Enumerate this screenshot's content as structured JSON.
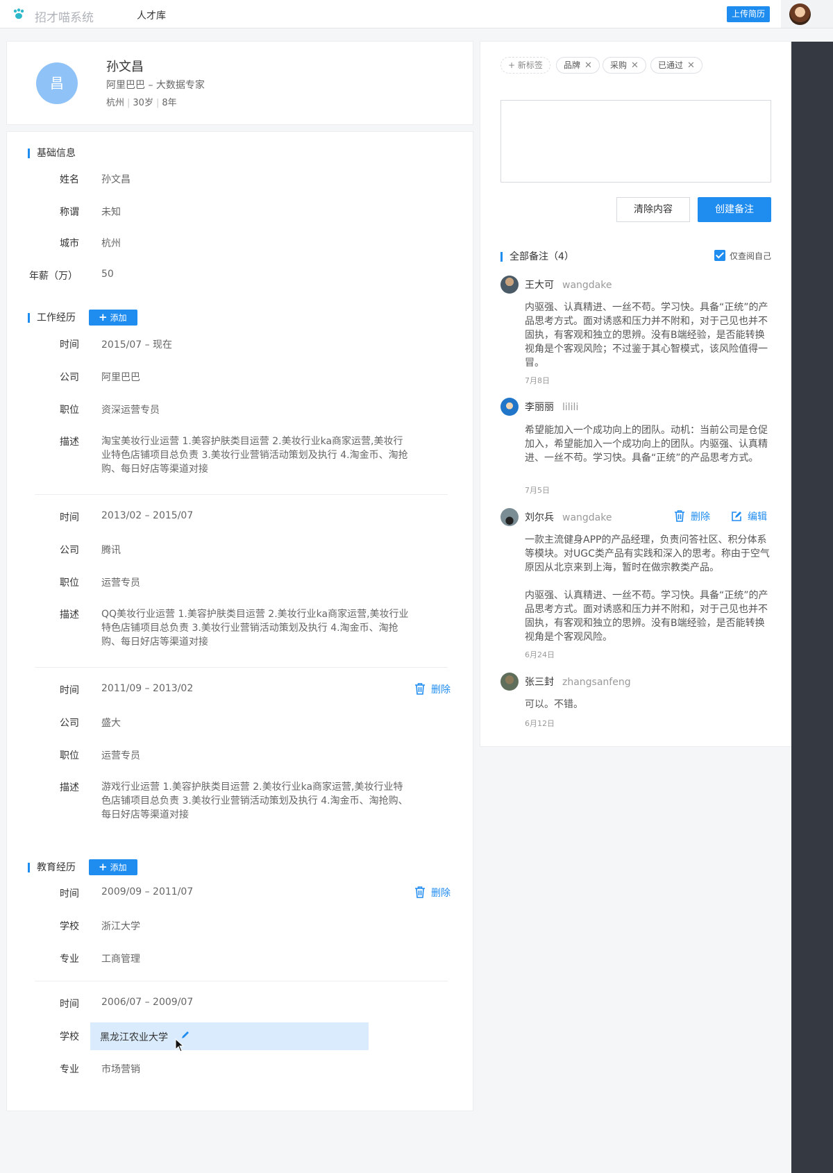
{
  "topbar": {
    "brand": "招才喵系统",
    "nav": "人才库",
    "upload": "上传简历"
  },
  "profile": {
    "avatar_char": "昌",
    "name": "孙文昌",
    "title": "阿里巴巴 – 大数据专家",
    "city": "杭州",
    "age": "30岁",
    "years": "8年"
  },
  "basic": {
    "title": "基础信息",
    "rows": [
      {
        "label": "姓名",
        "value": "孙文昌"
      },
      {
        "label": "称谓",
        "value": "未知"
      },
      {
        "label": "城市",
        "value": "杭州"
      },
      {
        "label": "年薪（万）",
        "value": "50"
      }
    ]
  },
  "work": {
    "title": "工作经历",
    "add": "添加",
    "labels": {
      "time": "时间",
      "company": "公司",
      "position": "职位",
      "desc": "描述"
    },
    "delete": "删除",
    "items": [
      {
        "time": "2015/07 – 现在",
        "company": "阿里巴巴",
        "position": "资深运营专员",
        "desc": "淘宝美妆行业运营 1.美容护肤类目运营 2.美妆行业ka商家运营,美妆行业特色店铺项目总负责 3.美妆行业营销活动策划及执行 4.淘金币、淘抢购、每日好店等渠道对接"
      },
      {
        "time": "2013/02 – 2015/07",
        "company": "腾讯",
        "position": "运营专员",
        "desc": "QQ美妆行业运营 1.美容护肤类目运营 2.美妆行业ka商家运营,美妆行业特色店铺项目总负责 3.美妆行业营销活动策划及执行 4.淘金币、淘抢购、每日好店等渠道对接"
      },
      {
        "time": "2011/09 – 2013/02",
        "company": "盛大",
        "position": "运营专员",
        "desc": "游戏行业运营 1.美容护肤类目运营 2.美妆行业ka商家运营,美妆行业特色店铺项目总负责 3.美妆行业营销活动策划及执行 4.淘金币、淘抢购、每日好店等渠道对接"
      }
    ]
  },
  "edu": {
    "title": "教育经历",
    "add": "添加",
    "labels": {
      "time": "时间",
      "school": "学校",
      "major": "专业"
    },
    "delete": "删除",
    "items": [
      {
        "time": "2009/09 – 2011/07",
        "school": "浙江大学",
        "major": "工商管理"
      },
      {
        "time": "2006/07 – 2009/07",
        "school": "黑龙江农业大学",
        "major": "市场营销"
      }
    ]
  },
  "tags": {
    "new": "新标签",
    "items": [
      "品牌",
      "采购",
      "已通过"
    ]
  },
  "note_form": {
    "clear": "清除内容",
    "create": "创建备注"
  },
  "notes": {
    "title": "全部备注（4）",
    "only_mine": "仅查阅自己",
    "delete": "删除",
    "edit": "编辑",
    "items": [
      {
        "name": "王大可",
        "nick": "wangdake",
        "text": "内驱强、认真精进、一丝不苟。学习快。具备“正统”的产品思考方式。面对诱惑和压力并不附和，对于己见也并不固执，有客观和独立的思辨。没有B端经验，是否能转换视角是个客观风险；不过鉴于其心智模式，该风险值得一冒。",
        "date": "7月8日"
      },
      {
        "name": "李丽丽",
        "nick": "lilili",
        "text": "希望能加入一个成功向上的团队。动机：当前公司是仓促加入，希望能加入一个成功向上的团队。内驱强、认真精进、一丝不苟。学习快。具备“正统”的产品思考方式。",
        "date": "7月5日"
      },
      {
        "name": "刘尔兵",
        "nick": "wangdake",
        "text": "一款主流健身APP的产品经理，负责问答社区、积分体系等模块。对UGC类产品有实践和深入的思考。称由于空气原因从北京来到上海，暂时在做宗教类产品。",
        "text2": "内驱强、认真精进、一丝不苟。学习快。具备“正统”的产品思考方式。面对诱惑和压力并不附和，对于己见也并不固执，有客观和独立的思辨。没有B端经验，是否能转换视角是个客观风险。",
        "date": "6月24日"
      },
      {
        "name": "张三封",
        "nick": "zhangsanfeng",
        "text": "可以。不错。",
        "date": "6月12日"
      }
    ]
  }
}
